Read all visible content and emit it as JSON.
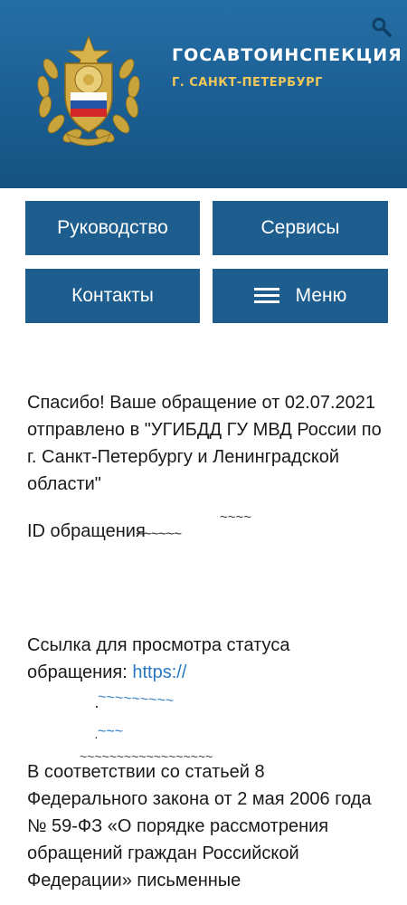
{
  "header": {
    "title": "ГОСАВТОИНСПЕКЦИЯ",
    "subtitle": "Г. САНКТ-ПЕТЕРБУРГ",
    "emblem_icon": "gibdd-emblem",
    "search_icon": "search-icon"
  },
  "nav": {
    "leadership": "Руководство",
    "services": "Сервисы",
    "contacts": "Контакты",
    "menu": "Меню"
  },
  "content": {
    "confirmation": "Спасибо! Ваше обращение от 02.07.2021 отправлено в \"УГИБДД ГУ МВД России по г. Санкт-Петербургу и Ленинградской области\"",
    "id_label": "ID обращения",
    "status_link_label": "Ссылка для просмотра статуса обращения:",
    "status_link": "https://",
    "law_text": "В соответствии со статьей 8 Федерального закона от 2 мая 2006 года № 59-ФЗ «О порядке рассмотрения обращений граждан Российской Федерации» письменные"
  },
  "colors": {
    "header_bg": "#1d5e8e",
    "button_bg": "#1d5e8e",
    "subtitle": "#f0c75a",
    "link": "#2a78c2"
  }
}
